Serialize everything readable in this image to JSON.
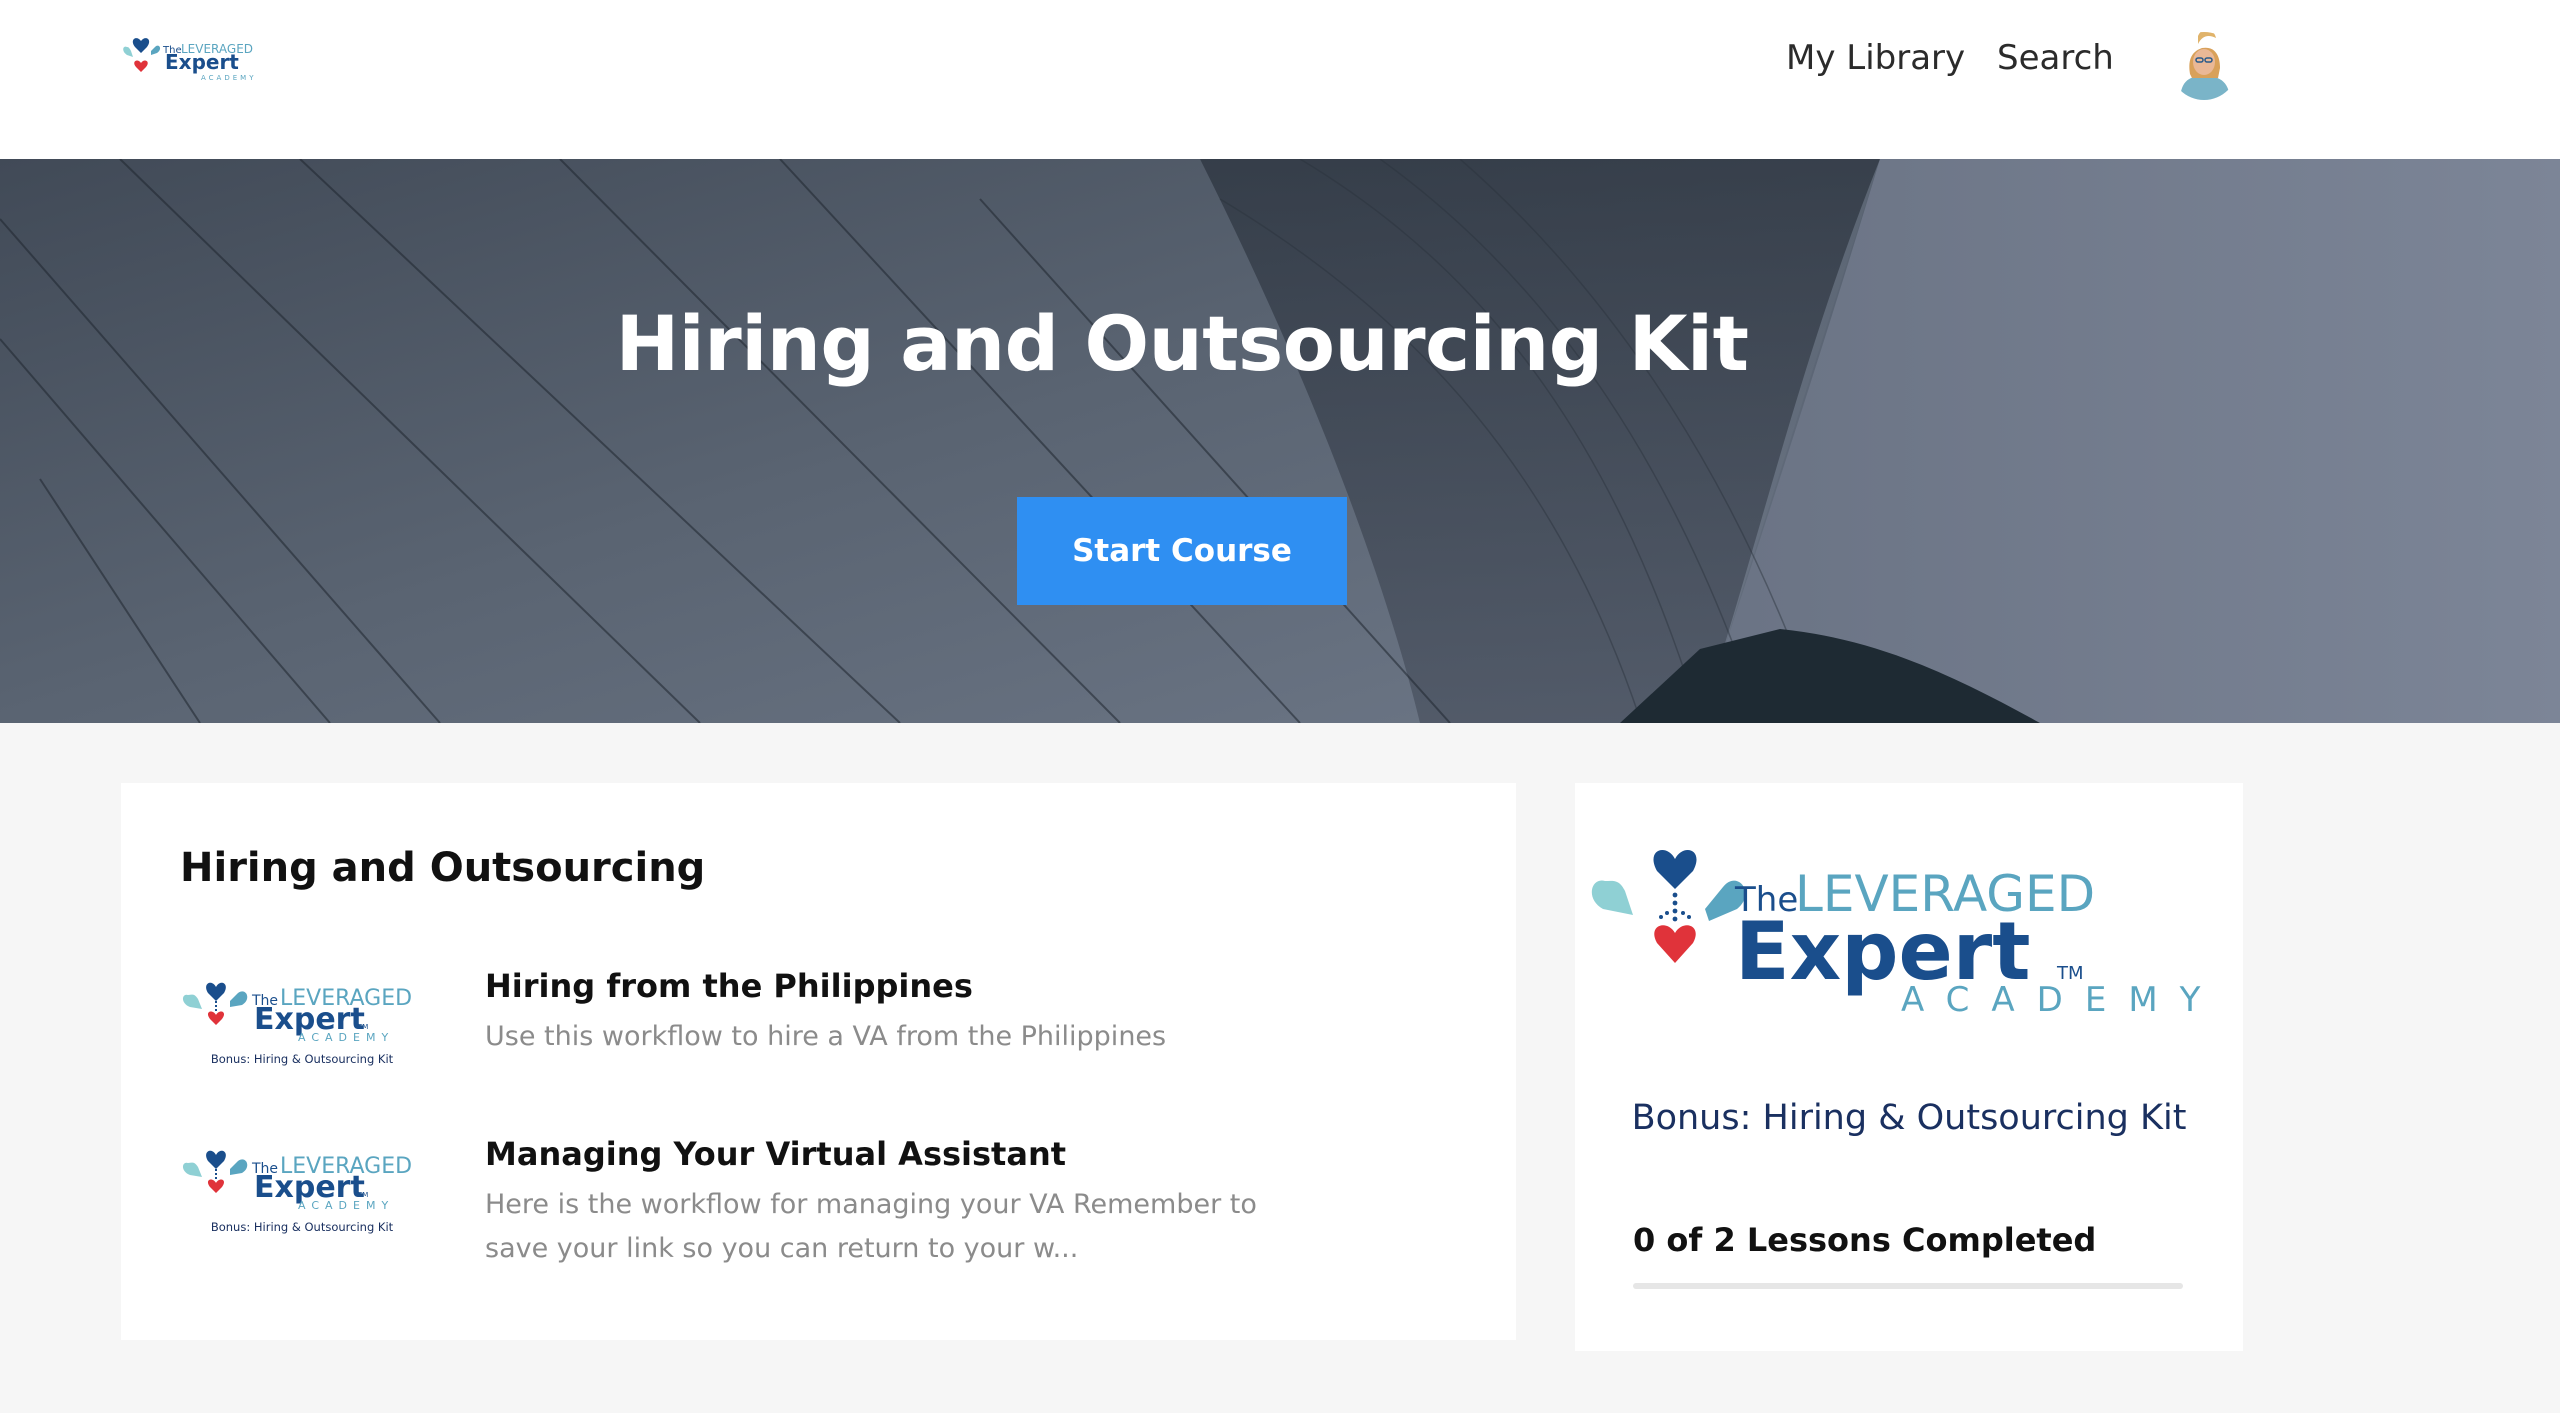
{
  "header": {
    "logo_alt": "The Leveraged Expert Academy",
    "nav": {
      "library": "My Library",
      "search": "Search"
    }
  },
  "hero": {
    "title": "Hiring and Outsourcing Kit",
    "button": "Start Course"
  },
  "lessons": {
    "section_title": "Hiring and Outsourcing",
    "items": [
      {
        "title": "Hiring from the Philippines",
        "description": "Use this workflow to hire a VA from the Philippines",
        "thumb_caption": "Bonus: Hiring & Outsourcing Kit"
      },
      {
        "title": "Managing Your Virtual Assistant",
        "description": "Here is the workflow for managing your VA Remember to save your link so you can return to your w...",
        "thumb_caption": "Bonus: Hiring & Outsourcing Kit"
      }
    ]
  },
  "logo_text": {
    "the": "The",
    "leveraged": "LEVERAGED",
    "expert": "Expert",
    "tm": "TM",
    "academy": "ACADEMY"
  },
  "course": {
    "subtitle": "Bonus: Hiring & Outsourcing Kit",
    "progress_text": "0 of 2 Lessons Completed",
    "progress_fraction": 0
  },
  "colors": {
    "accent": "#2f8ff2",
    "logo_navy": "#1a4e8c",
    "logo_teal": "#5aa5c0",
    "heart_red": "#e0333a"
  }
}
